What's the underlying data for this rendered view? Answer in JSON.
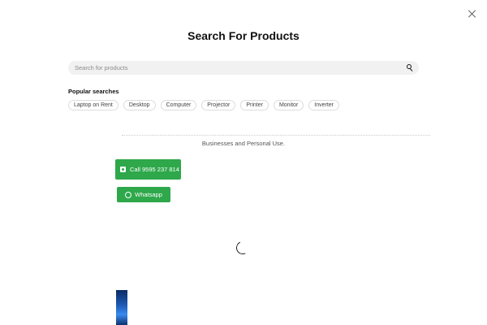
{
  "overlay": {
    "title": "Search For Products",
    "search": {
      "placeholder": "Search for products",
      "value": ""
    },
    "popular_label": "Popular searches",
    "popular_items": [
      "Laptop on Rent",
      "Desktop",
      "Computer",
      "Projector",
      "Printer",
      "Monitor",
      "Inverter"
    ]
  },
  "background": {
    "text": "Businesses and Personal Use.",
    "call_label": "Call 9595 237 814",
    "whatsapp_label": "Whatsapp"
  },
  "icons": {
    "close": "close-icon",
    "search": "search-icon",
    "phone": "phone-icon",
    "whatsapp": "whatsapp-icon",
    "loading": "loading-spinner-icon"
  },
  "colors": {
    "accent_green": "#2ea84a",
    "search_bg": "#f1f1f1"
  }
}
